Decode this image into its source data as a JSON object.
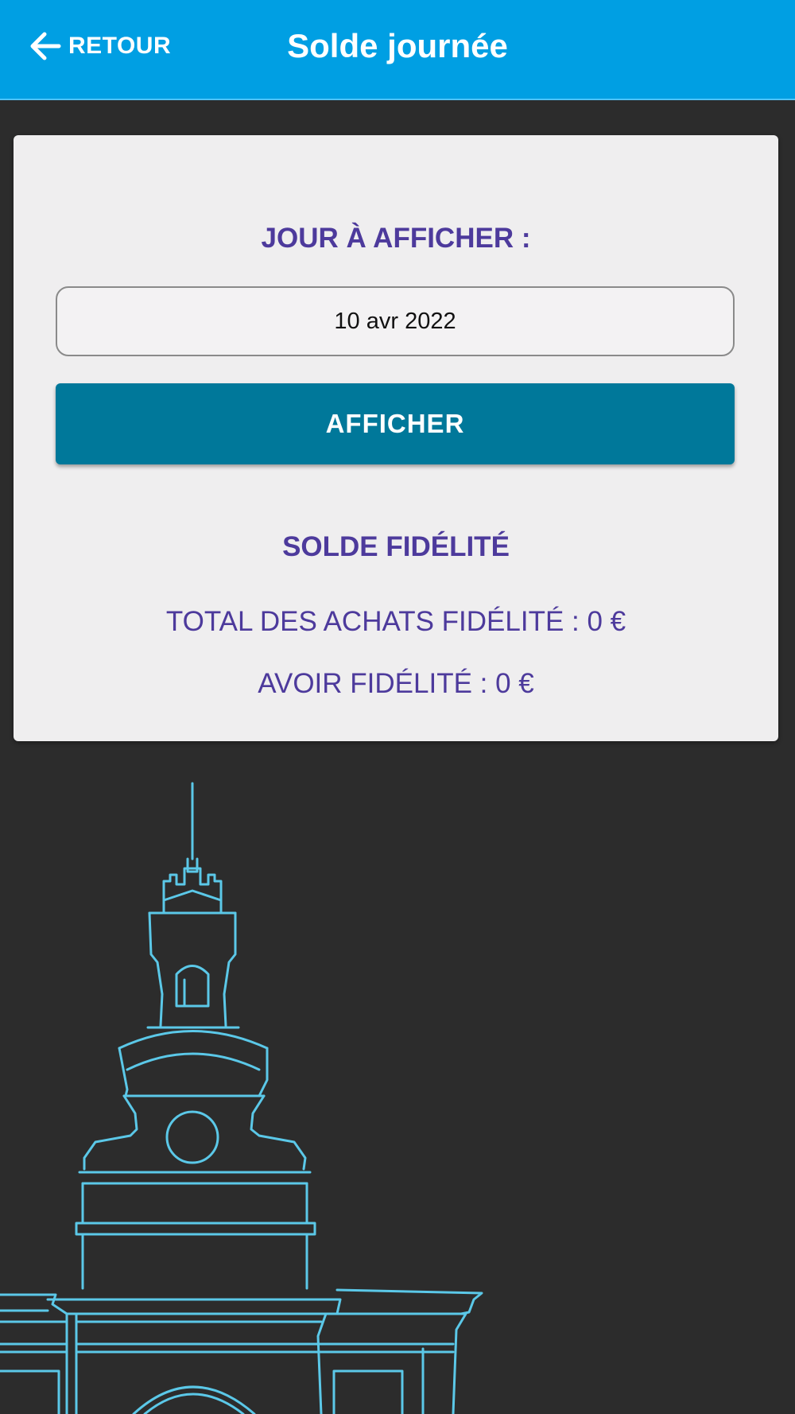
{
  "header": {
    "back_label": "RETOUR",
    "title": "Solde journée",
    "background_color": "#009fe3"
  },
  "card": {
    "day_label": "JOUR À AFFICHER :",
    "date_value": "10 avr 2022",
    "show_button_label": "AFFICHER",
    "loyalty_title": "SOLDE FIDÉLITÉ",
    "total_purchases": "TOTAL DES ACHATS FIDÉLITÉ : 0 €",
    "loyalty_credit": "AVOIR FIDÉLITÉ : 0 €"
  },
  "colors": {
    "accent_text": "#4d3a9c",
    "button": "#00789a",
    "page_background": "#2c2c2c",
    "illustration_stroke": "#5bc8e8"
  },
  "icons": {
    "back": "arrow-left-icon",
    "illustration": "monument-line-drawing"
  }
}
